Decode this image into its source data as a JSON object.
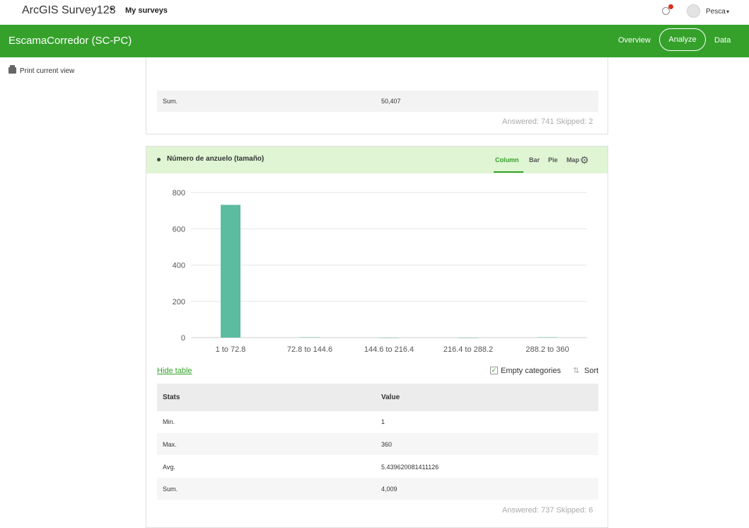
{
  "topbar": {
    "app_title": "ArcGIS Survey123",
    "caret": "▾",
    "my_surveys": "My surveys",
    "user_name": "Pesca",
    "user_caret": "▾"
  },
  "header": {
    "survey_title": "EscamaCorredor (SC-PC)",
    "nav": {
      "overview": "Overview",
      "analyze": "Analyze",
      "data": "Data"
    }
  },
  "print_label": "Print current view",
  "card1": {
    "sum_label": "Sum.",
    "sum_value": "50,407",
    "answered": "Answered: 741  Skipped: 2"
  },
  "card2": {
    "question": "Número de anzuelo (tamaño)",
    "tabs": {
      "column": "Column",
      "bar": "Bar",
      "pie": "Pie",
      "map": "Map"
    },
    "gear": "⚙",
    "hide_table": "Hide table",
    "check_mark": "✓",
    "empty_categories": "Empty categories",
    "sort_icon": "⇅",
    "sort": "Sort",
    "table": {
      "headers": {
        "stats": "Stats",
        "value": "Value"
      },
      "rows": [
        {
          "stat": "Min.",
          "value": "1"
        },
        {
          "stat": "Max.",
          "value": "360"
        },
        {
          "stat": "Avg.",
          "value": "5.439620081411126"
        },
        {
          "stat": "Sum.",
          "value": "4,009"
        }
      ]
    },
    "answered": "Answered: 737  Skipped: 6"
  },
  "colors": {
    "green": "#35a12b",
    "bar": "#5cbca0",
    "header_bg": "#dff5d3"
  },
  "chart_data": {
    "type": "bar",
    "categories": [
      "1 to 72.8",
      "72.8 to 144.6",
      "144.6 to 216.4",
      "216.4 to 288.2",
      "288.2 to 360"
    ],
    "values": [
      732,
      2,
      0,
      0,
      2
    ],
    "yticks": [
      0,
      200,
      400,
      600,
      800
    ],
    "ylim": [
      0,
      800
    ],
    "grid": true,
    "title": "",
    "xlabel": "",
    "ylabel": ""
  }
}
